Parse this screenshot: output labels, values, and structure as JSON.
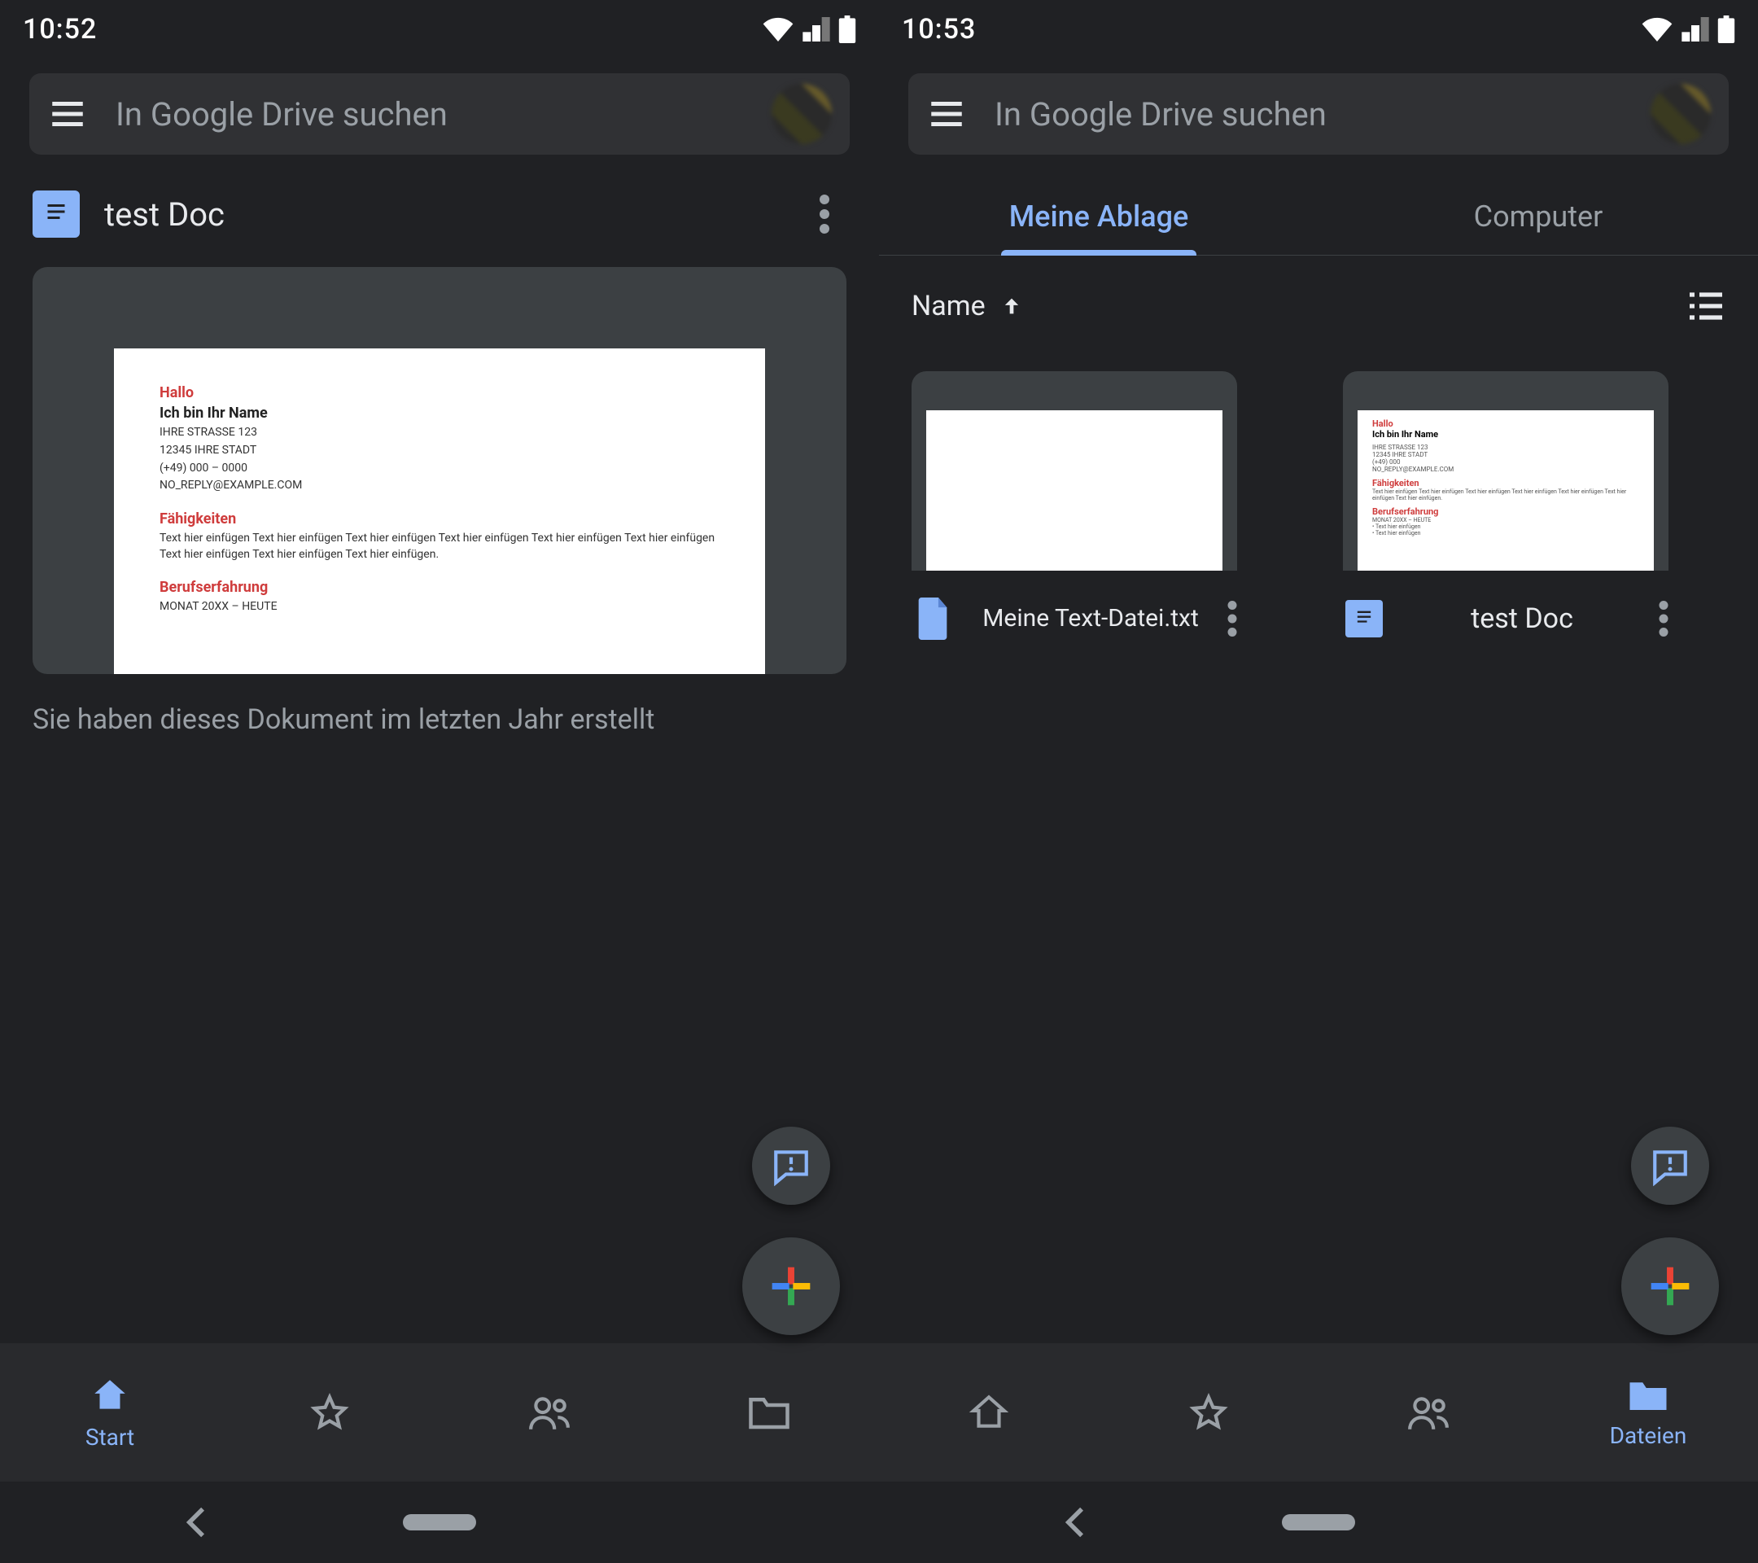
{
  "left": {
    "status_time": "10:52",
    "search_placeholder": "In Google Drive suchen",
    "doc_title": "test Doc",
    "subtext": "Sie haben dieses Dokument im letzten Jahr erstellt",
    "nav": {
      "start": "Start"
    },
    "preview": {
      "h_hallo": "Hallo",
      "h_name": "Ich bin Ihr Name",
      "addr1": "IHRE STRASSE 123",
      "addr2": "12345 IHRE STADT",
      "phone": "(+49) 000 – 0000",
      "email": "NO_REPLY@EXAMPLE.COM",
      "h_skills": "Fähigkeiten",
      "skills_body": "Text hier einfügen Text hier einfügen Text hier einfügen Text hier einfügen Text hier einfügen Text hier einfügen Text hier einfügen Text hier einfügen Text hier einfügen.",
      "h_exp": "Berufserfahrung",
      "exp_line": "MONAT 20XX – HEUTE"
    }
  },
  "right": {
    "status_time": "10:53",
    "search_placeholder": "In Google Drive suchen",
    "tabs": {
      "mine": "Meine Ablage",
      "computer": "Computer"
    },
    "sort_label": "Name",
    "files": [
      {
        "name": "Meine Text-Datei.txt"
      },
      {
        "name": "test Doc"
      }
    ],
    "nav": {
      "files": "Dateien"
    },
    "preview": {
      "h_hallo": "Hallo",
      "h_name": "Ich bin Ihr Name",
      "h_skills": "Fähigkeiten",
      "h_exp": "Berufserfahrung"
    }
  }
}
